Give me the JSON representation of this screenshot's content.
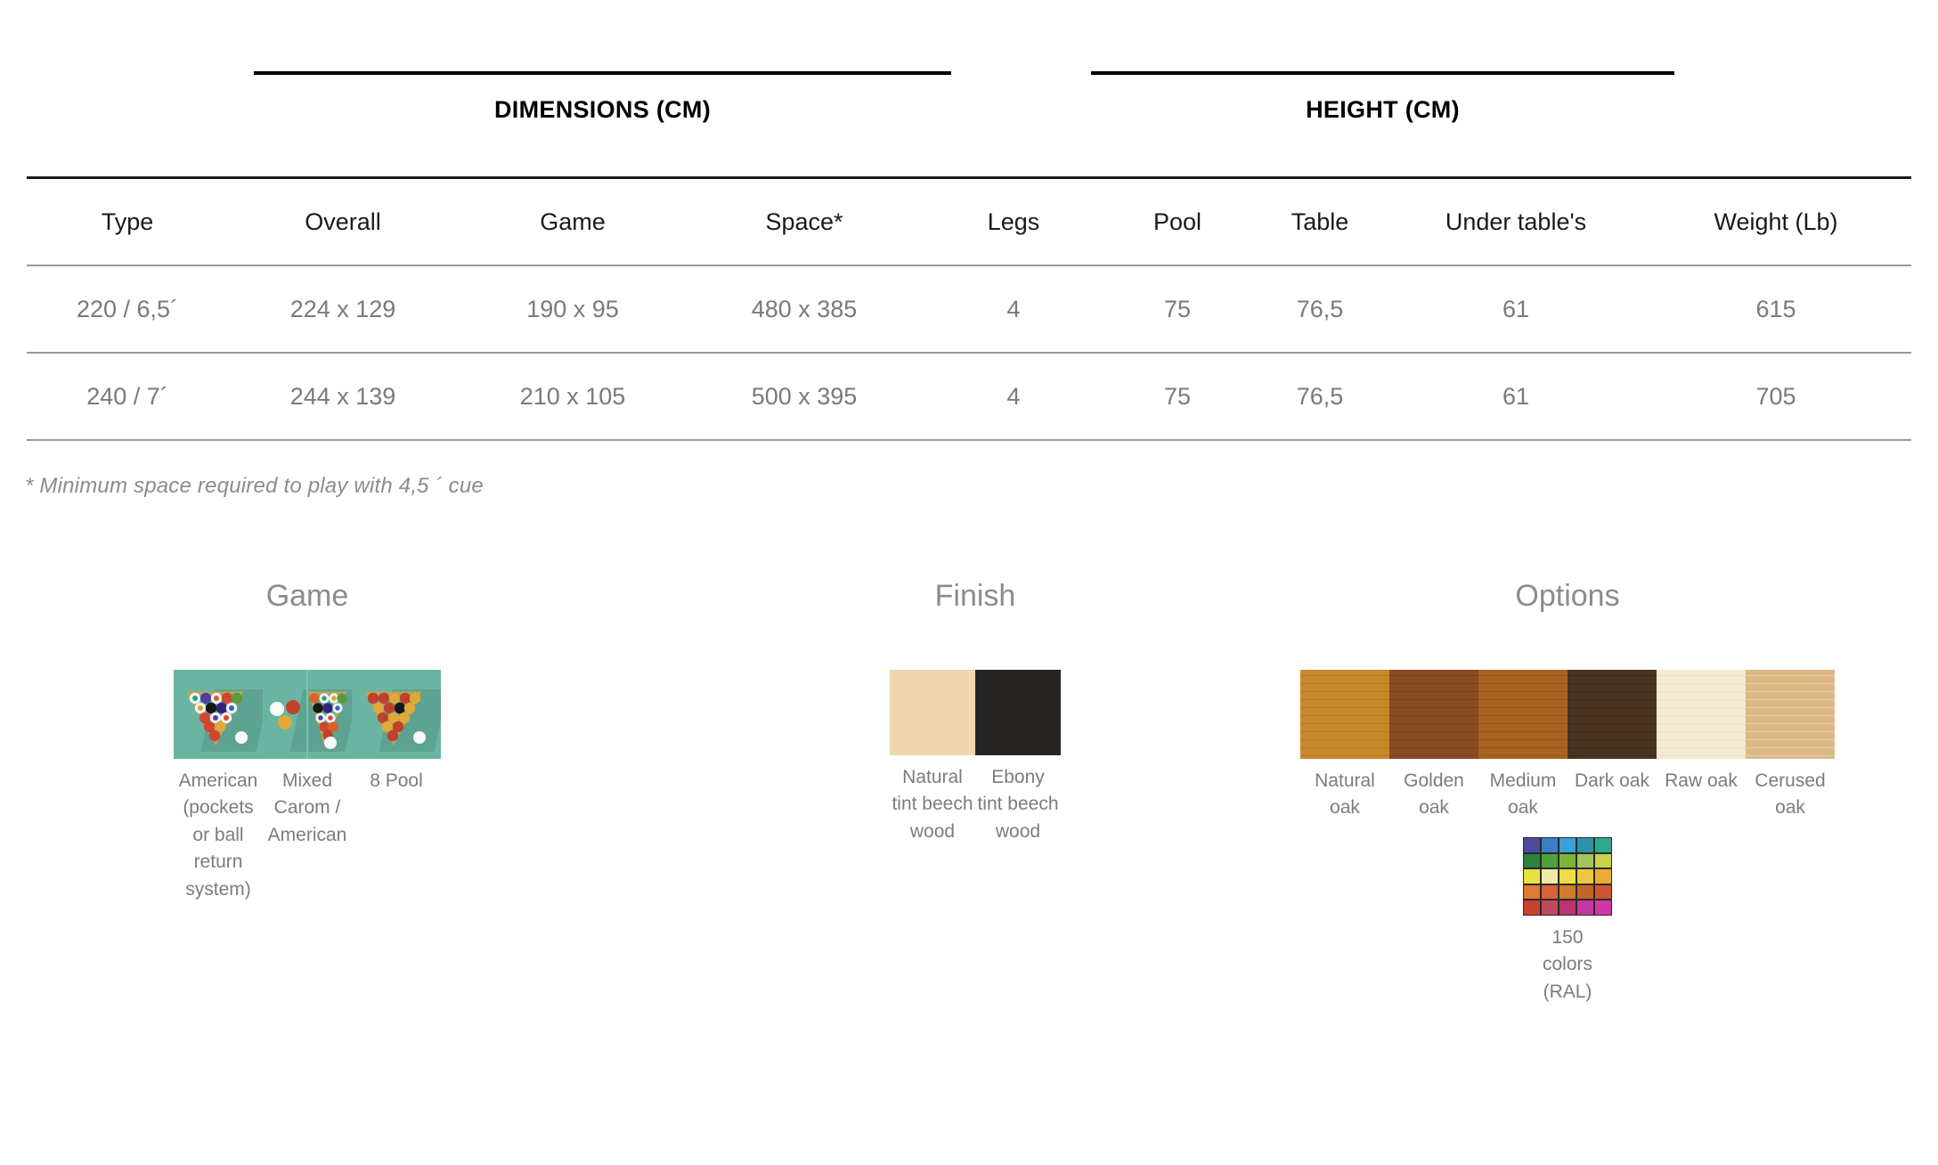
{
  "table": {
    "group_headers": [
      {
        "label": "DIMENSIONS (CM)"
      },
      {
        "label": "HEIGHT (CM)"
      }
    ],
    "columns": [
      "Type",
      "Overall",
      "Game",
      "Space*",
      "Legs",
      "Pool",
      "Table",
      "Under table's",
      "Weight (Lb)"
    ],
    "rows": [
      {
        "type": "220 / 6,5´",
        "overall": "224 x 129",
        "game": "190 x 95",
        "space": "480 x 385",
        "legs": "4",
        "pool": "75",
        "table": "76,5",
        "under_tables": "61",
        "weight": "615"
      },
      {
        "type": "240 / 7´",
        "overall": "244 x 139",
        "game": "210 x 105",
        "space": "500 x 395",
        "legs": "4",
        "pool": "75",
        "table": "76,5",
        "under_tables": "61",
        "weight": "705"
      }
    ],
    "footnote": "* Minimum space required to play with 4,5 ´ cue"
  },
  "sections": {
    "game": {
      "title": "Game",
      "items": [
        {
          "label": "American\n(pockets\nor ball\nreturn\nsystem)",
          "icon": "billiard-rack-american",
          "bg": "#69b5a2"
        },
        {
          "label": "Mixed\nCarom /\nAmerican",
          "icon": "billiard-rack-mixed",
          "bg": "#69b5a2"
        },
        {
          "label": "8 Pool",
          "icon": "billiard-rack-8pool",
          "bg": "#69b5a2"
        }
      ]
    },
    "finish": {
      "title": "Finish",
      "items": [
        {
          "label": "Natural\ntint beech\nwood",
          "color": "#efd6ae"
        },
        {
          "label": "Ebony\ntint beech\nwood",
          "color": "#262524"
        }
      ]
    },
    "options": {
      "title": "Options",
      "items": [
        {
          "label": "Natural\noak",
          "color": "#c8882c",
          "grain": "#a76f1f"
        },
        {
          "label": "Golden\noak",
          "color": "#8a4a22",
          "grain": "#6d3718"
        },
        {
          "label": "Medium\noak",
          "color": "#a9621f",
          "grain": "#854a16"
        },
        {
          "label": "Dark oak",
          "color": "#4a3320",
          "grain": "#362315"
        },
        {
          "label": "Raw oak",
          "color": "#f2ead2",
          "grain": "#e3d8ba"
        },
        {
          "label": "Cerused oak",
          "color": "#dcb884",
          "grain": "#f3e2cb"
        }
      ],
      "ral": {
        "label": "150\ncolors\n(RAL)",
        "swatch_name": "ral-color-palette",
        "colors": [
          "#4f4a9e",
          "#3a7fc4",
          "#35a2da",
          "#2e93a8",
          "#2fa98e",
          "#2f8140",
          "#4ea13e",
          "#7cb43a",
          "#9fc55b",
          "#c8d24a",
          "#e8e23f",
          "#eeeaa8",
          "#eedd45",
          "#edc740",
          "#e9ad36",
          "#e07932",
          "#d9613c",
          "#d07c2a",
          "#c4642a",
          "#cf5434",
          "#c7412f",
          "#c04a5e",
          "#b93470",
          "#c337a0",
          "#cf38a4"
        ]
      }
    }
  }
}
